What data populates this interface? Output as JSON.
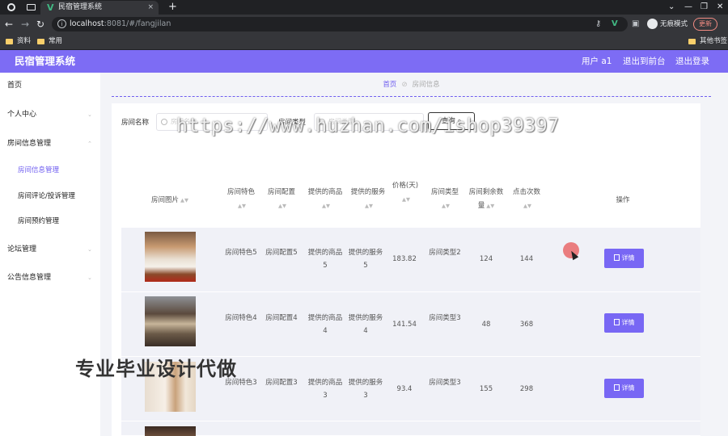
{
  "browser": {
    "tab_title": "民宿管理系统",
    "tab_close": "×",
    "new_tab": "+",
    "url_host": "localhost",
    "url_path": ":8081/#/fangjilan",
    "incognito_label": "无痕模式",
    "update_label": "更新",
    "bookmarks": [
      "资料",
      "常用"
    ],
    "other_bookmarks": "其他书签",
    "win_controls": [
      "⌄",
      "—",
      "❐",
      "✕"
    ]
  },
  "header": {
    "title": "民宿管理系统",
    "user": "用户 a1",
    "back_front": "退出到前台",
    "logout": "退出登录"
  },
  "sidebar": {
    "items": [
      "首页",
      "个人中心",
      "房间信息管理",
      "论坛管理",
      "公告信息管理"
    ],
    "subitems": [
      "房间信息管理",
      "房间评论/投诉管理",
      "房间预约管理"
    ]
  },
  "breadcrumb": {
    "home": "首页",
    "sep": "⊘",
    "current": "房间信息"
  },
  "search": {
    "name_label": "房间名称",
    "name_placeholder": "房间名称",
    "type_label": "房间类型",
    "type_placeholder": "房间类型",
    "button": "查询"
  },
  "watermark": {
    "url": "https://www.huzhan.com/ishop39397",
    "slogan": "专业毕业设计代做"
  },
  "table": {
    "headers": [
      "房间图片",
      "房间特色",
      "房间配置",
      "提供的商品",
      "提供的服务",
      "价格(天)",
      "房间类型",
      "房间剩余数量",
      "点击次数",
      "操作"
    ],
    "rows": [
      {
        "feature": "房间特色5",
        "config": "房间配置5",
        "goods": "提供的商品5",
        "service": "提供的服务5",
        "price": "183.82",
        "type": "房间类型2",
        "remain": "124",
        "clicks": "144",
        "action": "详情"
      },
      {
        "feature": "房间特色4",
        "config": "房间配置4",
        "goods": "提供的商品4",
        "service": "提供的服务4",
        "price": "141.54",
        "type": "房间类型3",
        "remain": "48",
        "clicks": "368",
        "action": "详情"
      },
      {
        "feature": "房间特色3",
        "config": "房间配置3",
        "goods": "提供的商品3",
        "service": "提供的服务3",
        "price": "93.4",
        "type": "房间类型3",
        "remain": "155",
        "clicks": "298",
        "action": "详情"
      }
    ]
  },
  "colors": {
    "brand": "#7d6cf4",
    "button": "#7867f4",
    "active": "#6f5ef0"
  }
}
